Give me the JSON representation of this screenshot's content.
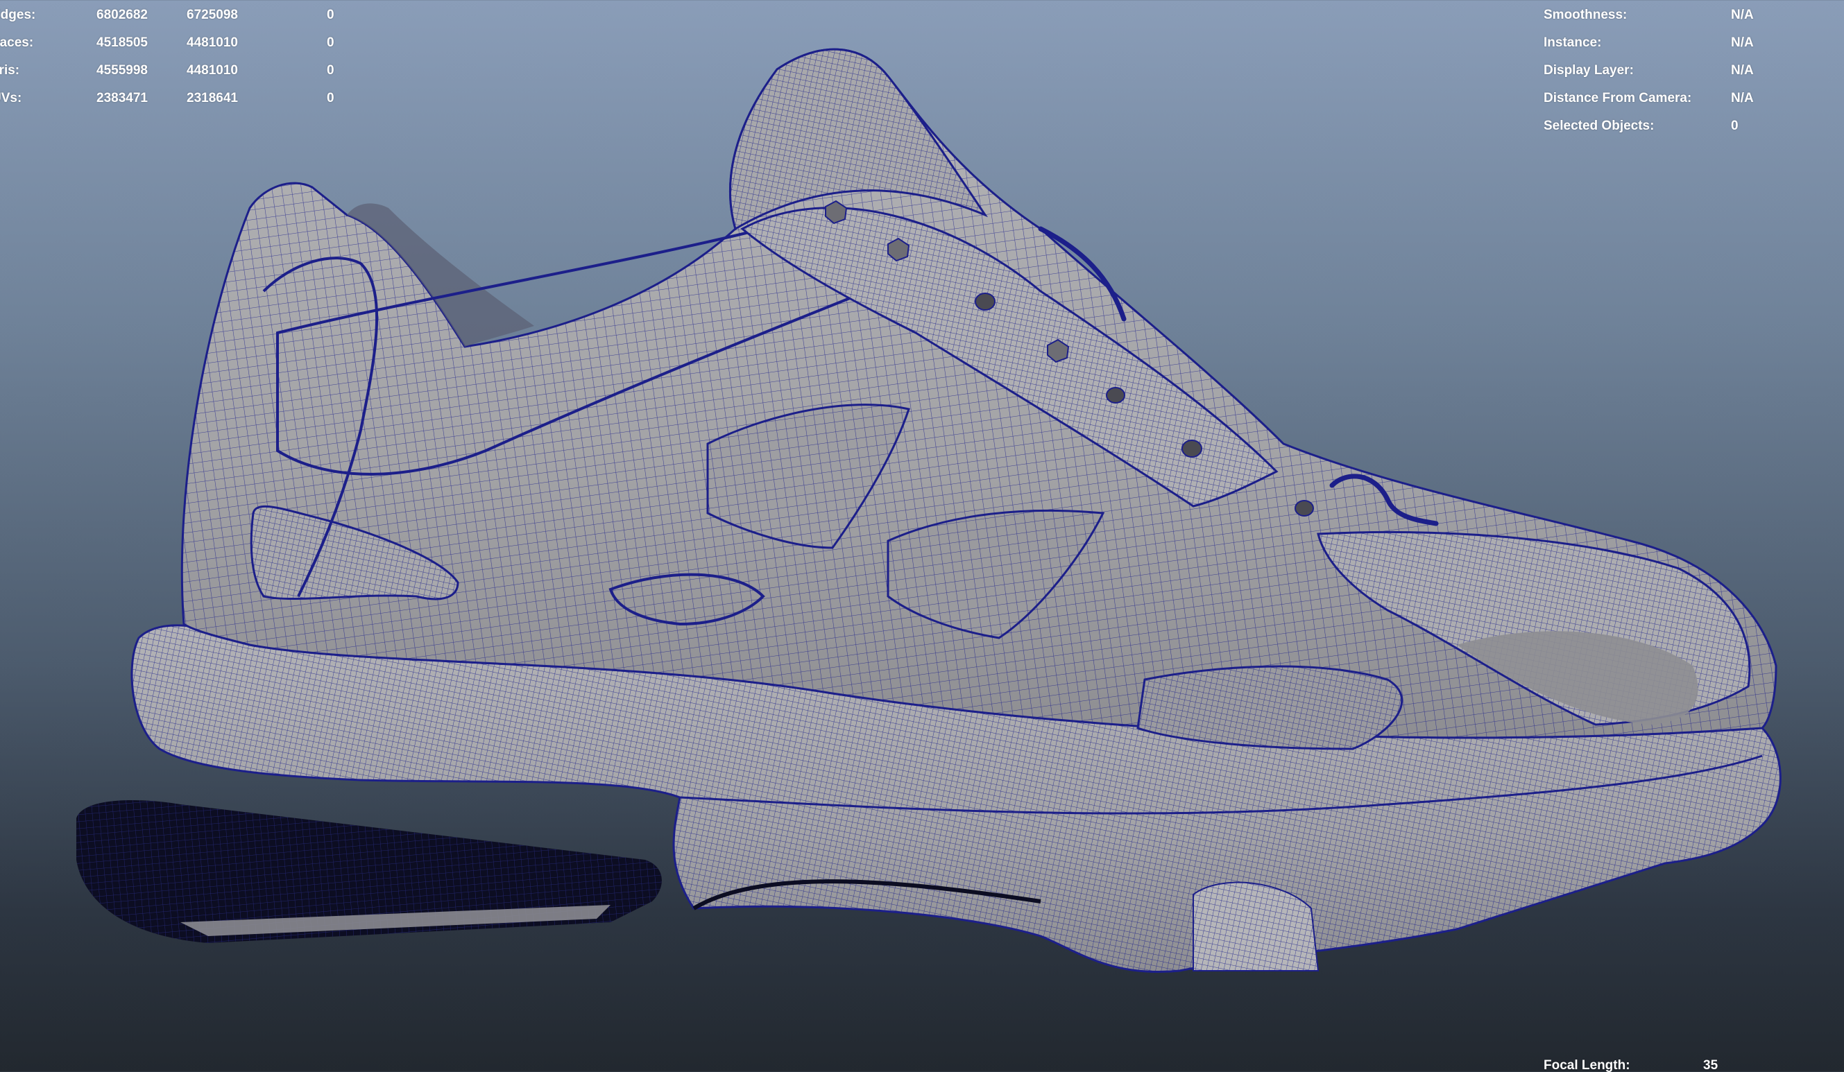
{
  "stats": {
    "rows": [
      {
        "label": "Edges:",
        "a": "6802682",
        "b": "6725098",
        "c": "0"
      },
      {
        "label": "Faces:",
        "a": "4518505",
        "b": "4481010",
        "c": "0"
      },
      {
        "label": "Tris:",
        "a": "4555998",
        "b": "4481010",
        "c": "0"
      },
      {
        "label": "UVs:",
        "a": "2383471",
        "b": "2318641",
        "c": "0"
      }
    ]
  },
  "object_info": {
    "rows": [
      {
        "label": "Smoothness:",
        "value": "N/A"
      },
      {
        "label": "Instance:",
        "value": "N/A"
      },
      {
        "label": "Display Layer:",
        "value": "N/A"
      },
      {
        "label": "Distance From Camera:",
        "value": "N/A"
      },
      {
        "label": "Selected Objects:",
        "value": "0"
      }
    ]
  },
  "camera": {
    "focal_length_label": "Focal Length:",
    "focal_length_value": "35"
  },
  "colors": {
    "wireframe": "#1c1f8a",
    "shaded_surface": "#a4a4a6",
    "background_top": "#8a9db8",
    "background_bottom": "#22282f",
    "hud_text": "#ffffff"
  },
  "icons": {
    "model": "sneaker-wireframe-model"
  }
}
